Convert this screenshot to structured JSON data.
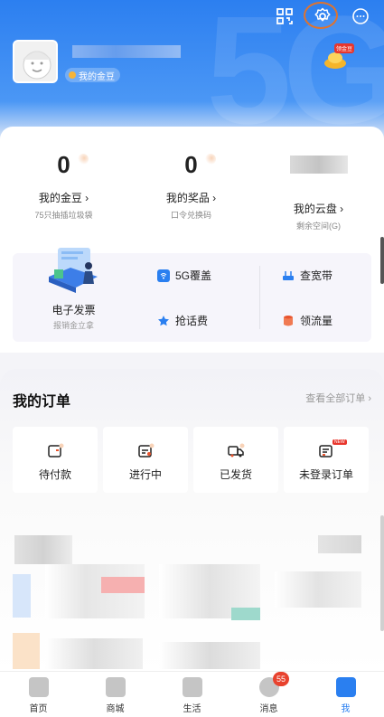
{
  "header": {
    "bean_badge": "我的金豆",
    "gold_tag": "领金豆",
    "background_text": "5G"
  },
  "stats": [
    {
      "value": "0",
      "title": "我的金豆",
      "sub": "75只抽插垃圾袋"
    },
    {
      "value": "0",
      "title": "我的奖品",
      "sub": "口令兑换码"
    },
    {
      "value": "",
      "title": "我的云盘",
      "sub": "剩余空间(G)"
    }
  ],
  "services": {
    "invoice_title": "电子发票",
    "invoice_sub": "报销金立拿",
    "items": [
      {
        "label": "5G覆盖",
        "icon": "5g-icon"
      },
      {
        "label": "查宽带",
        "icon": "router-icon"
      },
      {
        "label": "抢话费",
        "icon": "star-icon"
      },
      {
        "label": "领流量",
        "icon": "data-icon"
      }
    ]
  },
  "orders": {
    "title": "我的订单",
    "view_all": "查看全部订单",
    "items": [
      {
        "label": "待付款",
        "icon": "wallet-icon"
      },
      {
        "label": "进行中",
        "icon": "processing-icon"
      },
      {
        "label": "已发货",
        "icon": "truck-icon"
      },
      {
        "label": "未登录订单",
        "icon": "order-icon",
        "tag": "NEW"
      }
    ]
  },
  "tabbar": {
    "items": [
      {
        "label": "首页",
        "icon": "home-icon"
      },
      {
        "label": "商城",
        "icon": "bag-icon"
      },
      {
        "label": "生活",
        "icon": "cup-icon"
      },
      {
        "label": "消息",
        "icon": "message-icon",
        "badge": "55"
      },
      {
        "label": "我",
        "icon": "me-icon",
        "active": true
      }
    ]
  },
  "colors": {
    "brand": "#2a7ff0",
    "badge": "#e8422e",
    "settings_highlight": "#e0732d"
  }
}
